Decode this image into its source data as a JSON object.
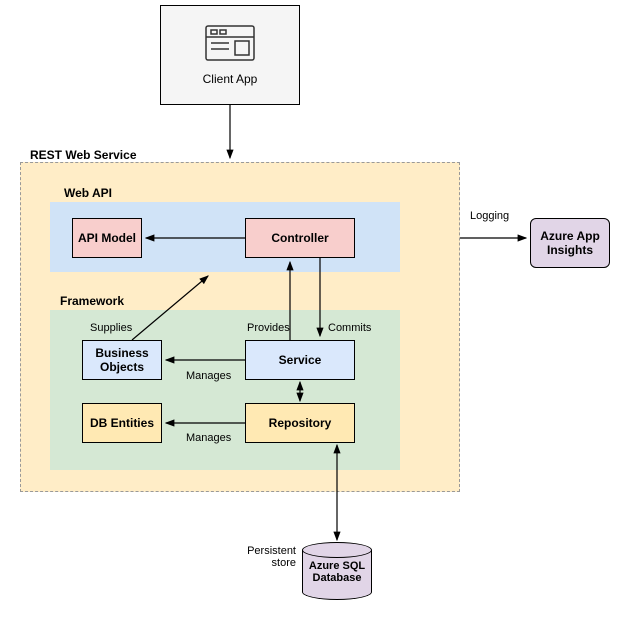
{
  "client": {
    "label": "Client App"
  },
  "rest": {
    "title": "REST Web Service"
  },
  "webapi": {
    "title": "Web API",
    "apiModel": "API Model",
    "controller": "Controller"
  },
  "framework": {
    "title": "Framework",
    "businessObjects": "Business Objects",
    "service": "Service",
    "dbEntities": "DB Entities",
    "repository": "Repository"
  },
  "edges": {
    "logging": "Logging",
    "supplies": "Supplies",
    "provides": "Provides",
    "commits": "Commits",
    "managesService": "Manages",
    "managesRepo": "Manages",
    "persistentStore": "Persistent store"
  },
  "external": {
    "appInsights": "Azure App Insights",
    "sqlDatabase": "Azure SQL Database"
  }
}
